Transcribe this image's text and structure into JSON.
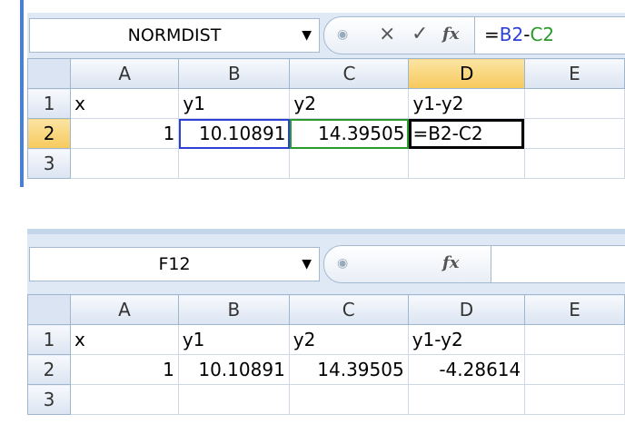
{
  "top": {
    "name_box": "NORMDIST",
    "formula_parts": [
      {
        "text": "=",
        "color": "#000000"
      },
      {
        "text": "B2",
        "color": "#2c3fd6"
      },
      {
        "text": "-",
        "color": "#000000"
      },
      {
        "text": "C2",
        "color": "#2a9a2a"
      }
    ],
    "columns": [
      "A",
      "B",
      "C",
      "D",
      "E"
    ],
    "rows": [
      {
        "num": "1",
        "cells": [
          "x",
          "y1",
          "y2",
          "y1-y2",
          ""
        ]
      },
      {
        "num": "2",
        "cells": [
          "1",
          "10.10891",
          "14.39505",
          "=B2-C2",
          ""
        ]
      },
      {
        "num": "3",
        "cells": [
          "",
          "",
          "",
          "",
          ""
        ]
      }
    ]
  },
  "bottom": {
    "name_box": "F12",
    "formula": "",
    "columns": [
      "A",
      "B",
      "C",
      "D",
      "E"
    ],
    "rows": [
      {
        "num": "1",
        "cells": [
          "x",
          "y1",
          "y2",
          "y1-y2",
          ""
        ]
      },
      {
        "num": "2",
        "cells": [
          "1",
          "10.10891",
          "14.39505",
          "-4.28614",
          ""
        ]
      },
      {
        "num": "3",
        "cells": [
          "",
          "",
          "",
          "",
          ""
        ]
      }
    ]
  },
  "icons": {
    "cancel": "×",
    "enter": "✓",
    "function": "fx",
    "dropdown": "▼"
  },
  "colors": {
    "ref_b": "#2c3fd6",
    "ref_c": "#2a9a2a",
    "selected_header": "#f7c95c"
  }
}
